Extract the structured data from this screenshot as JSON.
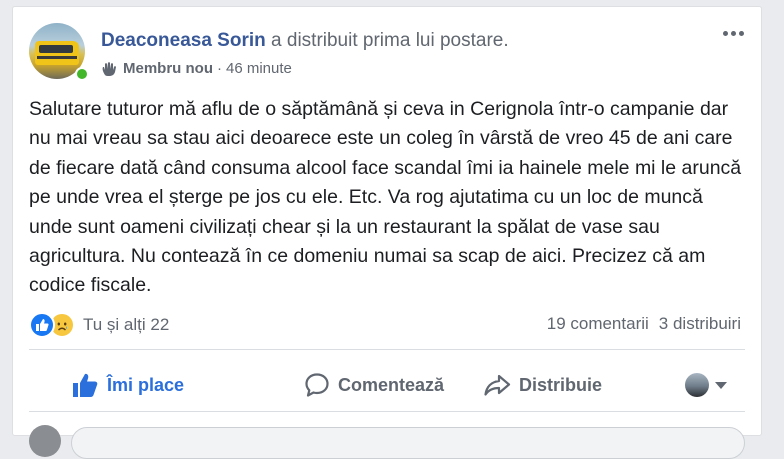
{
  "post": {
    "author": "Deaconeasa Sorin",
    "action_text": "a distribuit prima lui postare.",
    "badge": "Membru nou",
    "separator": "·",
    "time": "46 minute",
    "more_icon": "more-horizontal-icon",
    "text": "Salutare tuturor mă aflu de o săptămână și ceva in Cerignola într-o campanie dar nu mai vreau sa stau aici deoarece este un coleg în vârstă de vreo 45 de ani care de fiecare dată când consuma alcool face scandal îmi ia hainele mele mi le aruncă pe unde vrea el șterge pe jos cu ele. Etc. Va rog ajutatima cu un loc de muncă unde sunt oameni civilizați chear și la un restaurant la spălat de vase sau agricultura. Nu contează în ce domeniu numai sa scap de aici. Precizez că am codice fiscale."
  },
  "reactions": {
    "icons": [
      "like-reaction-icon",
      "sad-reaction-icon"
    ],
    "summary": "Tu și alți 22",
    "comments": "19 comentarii",
    "shares": "3 distribuiri"
  },
  "actions": {
    "like": "Îmi place",
    "comment": "Comentează",
    "share": "Distribuie"
  },
  "colors": {
    "author": "#385898",
    "like_active": "#2a6fdb",
    "online": "#42b72a",
    "text": "#1c1e21",
    "muted": "#616770"
  }
}
